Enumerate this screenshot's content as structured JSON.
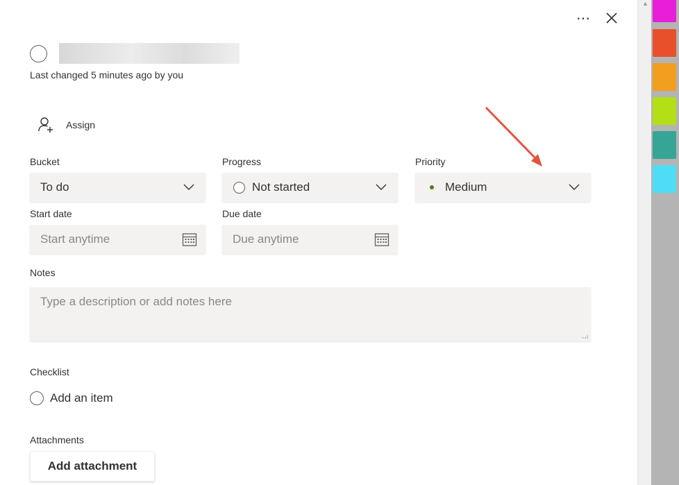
{
  "header": {
    "more_icon": "ellipsis-icon",
    "close_icon": "close-icon",
    "last_changed": "Last changed 5 minutes ago by you"
  },
  "assign": {
    "label": "Assign",
    "icon": "add-person-icon"
  },
  "bucket": {
    "label": "Bucket",
    "value": "To do"
  },
  "progress": {
    "label": "Progress",
    "value": "Not started"
  },
  "priority": {
    "label": "Priority",
    "value": "Medium",
    "dot_color": "#498205"
  },
  "start_date": {
    "label": "Start date",
    "placeholder": "Start anytime"
  },
  "due_date": {
    "label": "Due date",
    "placeholder": "Due anytime"
  },
  "notes": {
    "label": "Notes",
    "placeholder": "Type a description or add notes here"
  },
  "checklist": {
    "label": "Checklist",
    "add_item": "Add an item"
  },
  "attachments": {
    "label": "Attachments",
    "button": "Add attachment"
  },
  "label_swatches": [
    "#e81fd8",
    "#e8502b",
    "#f29e1f",
    "#b3df16",
    "#35a596",
    "#4fdcf6"
  ],
  "annotation_color": "#e5533d"
}
